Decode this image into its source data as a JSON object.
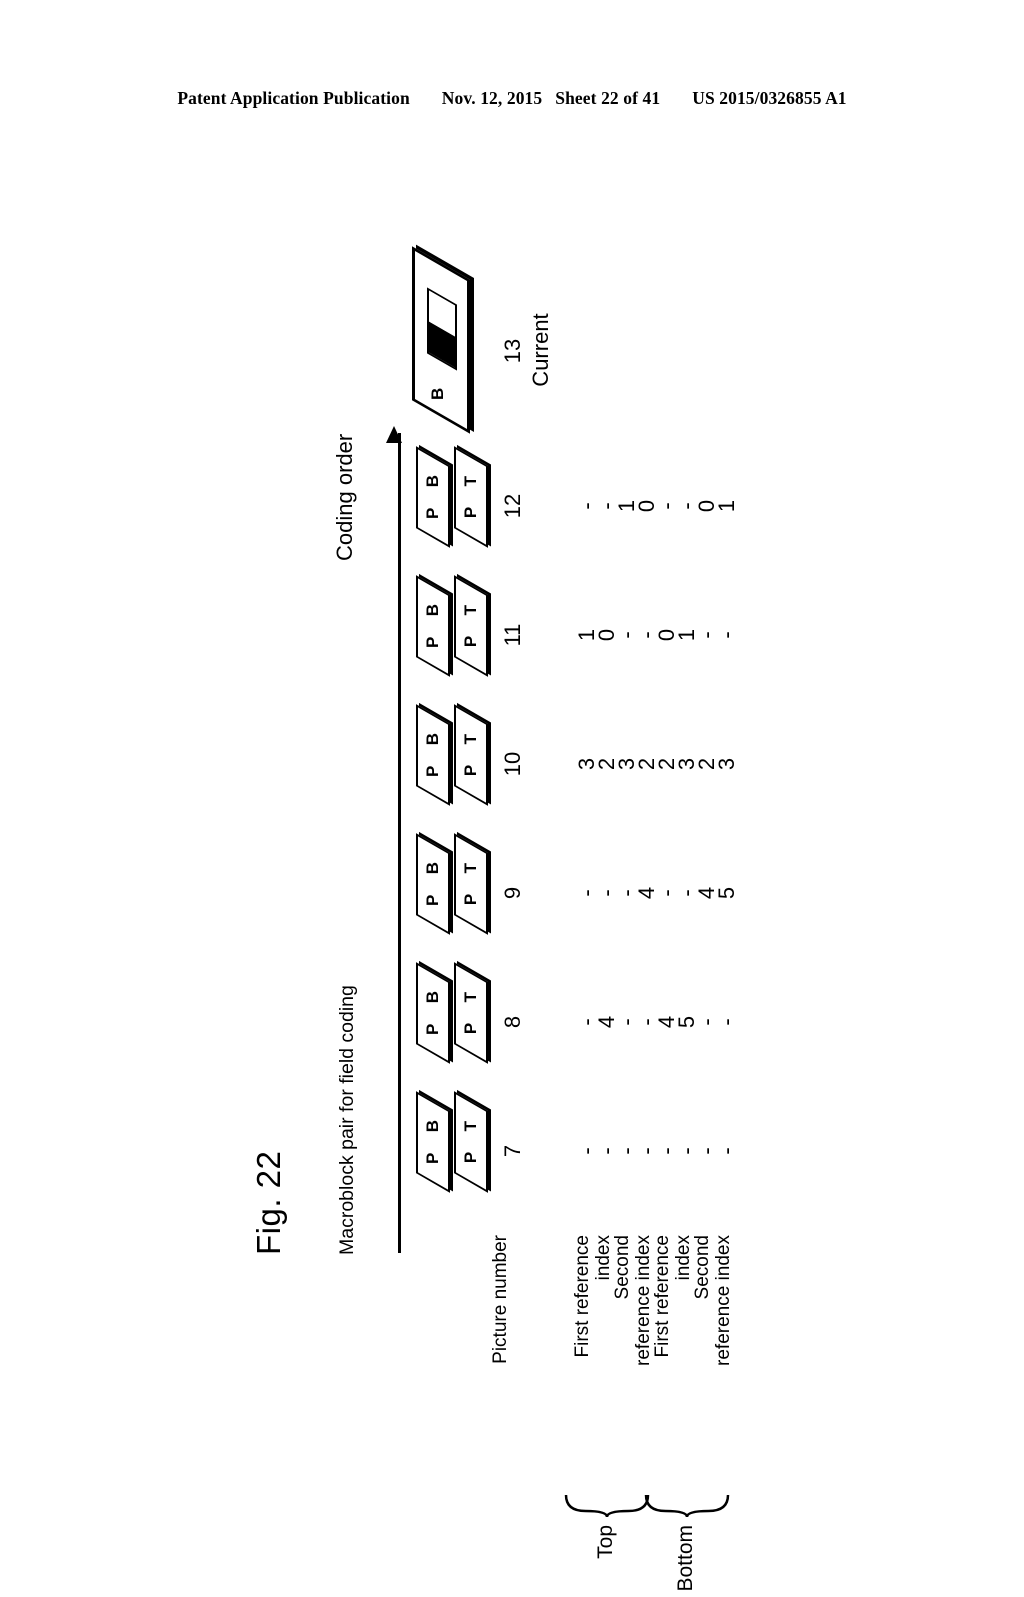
{
  "header": {
    "publication": "Patent Application Publication",
    "date": "Nov. 12, 2015",
    "sheet": "Sheet 22 of 41",
    "docnum": "US 2015/0326855 A1"
  },
  "figure": {
    "title": "Fig. 22",
    "caption": "Macroblock pair for field coding",
    "coding_order_label": "Coding order",
    "current_label": "Current",
    "current_number": "13",
    "current_block_letter": "B",
    "picture_number_label": "Picture number",
    "row_labels": [
      "First reference\nindex",
      "Second\nreference index",
      "First reference\nindex",
      "Second\nreference index"
    ],
    "group_labels": {
      "top": "Top",
      "bottom": "Bottom"
    },
    "field_labels": {
      "bottom_field": "P B",
      "top_field": "P T"
    },
    "pictures": [
      {
        "number": "12",
        "bottom": [
          "-",
          "1",
          "-",
          "0"
        ],
        "top": [
          "-",
          "0",
          "-",
          "1"
        ]
      },
      {
        "number": "11",
        "bottom": [
          "1",
          "-",
          "0",
          "-"
        ],
        "top": [
          "0",
          "-",
          "1",
          "-"
        ]
      },
      {
        "number": "10",
        "bottom": [
          "3",
          "3",
          "2",
          "2"
        ],
        "top": [
          "2",
          "2",
          "3",
          "3"
        ]
      },
      {
        "number": "9",
        "bottom": [
          "-",
          "-",
          "-",
          "4"
        ],
        "top": [
          "-",
          "4",
          "-",
          "5"
        ]
      },
      {
        "number": "8",
        "bottom": [
          "-",
          "-",
          "4",
          "-"
        ],
        "top": [
          "4",
          "-",
          "5",
          "-"
        ]
      },
      {
        "number": "7",
        "bottom": [
          "-",
          "-",
          "-",
          "-"
        ],
        "top": [
          "-",
          "-",
          "-",
          "-"
        ]
      }
    ]
  }
}
